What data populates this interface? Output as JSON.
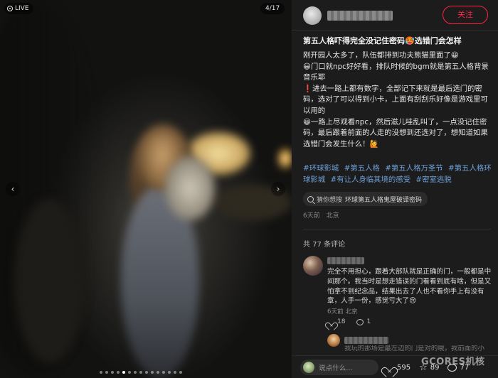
{
  "media": {
    "live_label": "LIVE",
    "counter": "4/17",
    "prev_glyph": "‹",
    "next_glyph": "›",
    "dot_count": 15,
    "active_dot": 4
  },
  "author": {
    "follow_label": "关注"
  },
  "post": {
    "title": "第五人格吓得完全没记住密码🥵选错门会怎样",
    "paragraphs": [
      "刚开园人太多了，队伍都排到功夫熊猫里面了😀",
      "😀门口就npc好好看，排队时候的bgm就是第五人格背景音乐耶",
      "❗进去一路上都有数字，全部记下来就是最后选门的密码，选对了可以得到小卡，上面有刮刮乐好像是游戏里可以用的",
      "😀一路上尽观看npc，然后滋儿哇乱叫了，一点没记住密码，最后跟着前面的人走的没想到还选对了，想知道如果选错门会发生什么！🙋"
    ],
    "tags": [
      "#环球影城",
      "#第五人格",
      "#第五人格万圣节",
      "#第五人格环球影城",
      "#有让人身临其境的感受",
      "#密室逃脱"
    ],
    "search_chip": {
      "prefix": "猜你想搜",
      "query": "环球第五人格鬼屋破译密码"
    },
    "time": "6天前",
    "location": "北京"
  },
  "comments": {
    "count_label": "共 77 条评论",
    "items": [
      {
        "text": "完全不用担心，跟着大部队就是正确的门，一般都是中间那个。我当时是想走错误的门看看到底有啥，但是又怕拿不到纪念品，结果出去了人也不看你手上有没有章，人手一份，感觉亏大了😢",
        "time": "6天前",
        "location": "北京",
        "likes": "18",
        "replies": "1"
      },
      {
        "text": "我玩的那场是最左边的门是对的哦，我前面的小"
      }
    ]
  },
  "bottom_bar": {
    "input_placeholder": "说点什么...",
    "likes": "595",
    "collects": "89",
    "comments": "77"
  },
  "watermark": "GCORES机核",
  "colors": {
    "accent": "#ff2442",
    "tag": "#6ea0d8",
    "panel_bg": "#1c1c1c"
  }
}
